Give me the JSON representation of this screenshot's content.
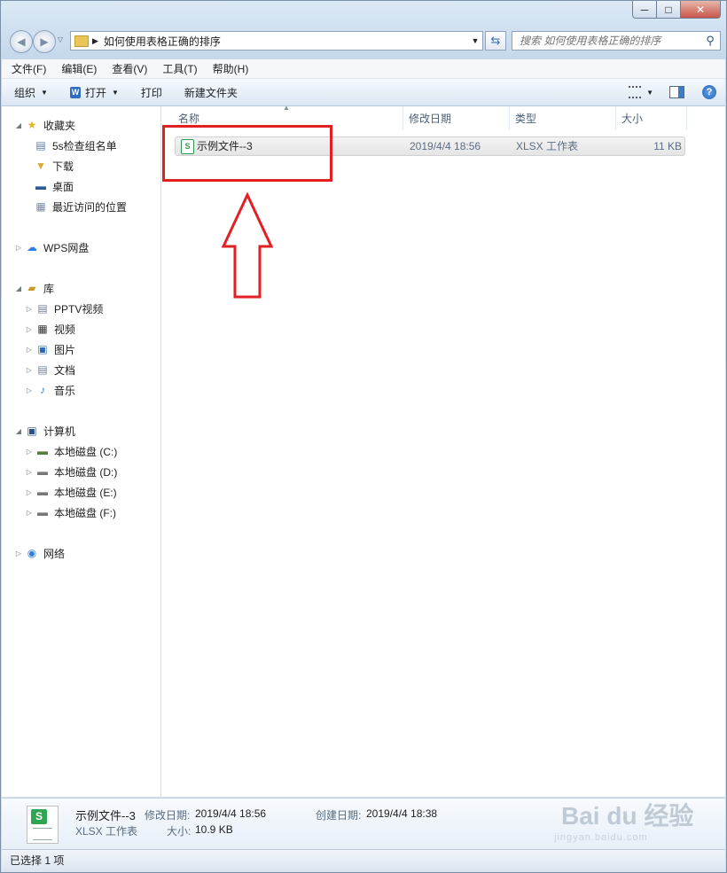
{
  "window": {
    "controls": {
      "minimize": "─",
      "maximize": "□",
      "close": "✕"
    }
  },
  "address": {
    "path": "如何使用表格正确的排序"
  },
  "search": {
    "placeholder": "搜索 如何使用表格正确的排序"
  },
  "menu": [
    "文件(F)",
    "编辑(E)",
    "查看(V)",
    "工具(T)",
    "帮助(H)"
  ],
  "toolbar": {
    "organize": "组织",
    "open": "打开",
    "print": "打印",
    "new_folder": "新建文件夹"
  },
  "nav": {
    "favorites": {
      "label": "收藏夹",
      "items": [
        "5s检查组名单",
        "下载",
        "桌面",
        "最近访问的位置"
      ]
    },
    "wps": "WPS网盘",
    "library": {
      "label": "库",
      "items": [
        "PPTV视频",
        "视频",
        "图片",
        "文档",
        "音乐"
      ]
    },
    "computer": {
      "label": "计算机",
      "items": [
        "本地磁盘 (C:)",
        "本地磁盘 (D:)",
        "本地磁盘 (E:)",
        "本地磁盘 (F:)"
      ]
    },
    "network": "网络"
  },
  "columns": {
    "name": "名称",
    "modified": "修改日期",
    "type": "类型",
    "size": "大小"
  },
  "files": [
    {
      "name": "示例文件--3",
      "modified": "2019/4/4 18:56",
      "type": "XLSX 工作表",
      "size": "11 KB",
      "icon": "xlsx-icon"
    }
  ],
  "details": {
    "name": "示例文件--3",
    "type": "XLSX 工作表",
    "modified_label": "修改日期:",
    "modified": "2019/4/4 18:56",
    "created_label": "创建日期:",
    "created": "2019/4/4 18:38",
    "size_label": "大小:",
    "size": "10.9 KB"
  },
  "status": {
    "text": "已选择 1 项"
  },
  "watermark": {
    "brand": "Bai du 经验",
    "url": "jingyan.baidu.com"
  },
  "annotation": {
    "color": "#e21f23"
  }
}
